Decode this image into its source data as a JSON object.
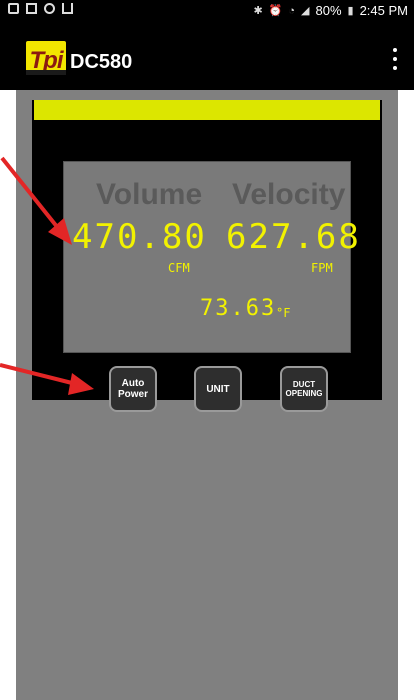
{
  "status_bar": {
    "battery": "80%",
    "time": "2:45 PM"
  },
  "app_bar": {
    "logo_text": "Tpi",
    "title": "DC580"
  },
  "display": {
    "volume_label": "Volume",
    "velocity_label": "Velocity",
    "volume_value": "470.80",
    "velocity_value": "627.68",
    "volume_unit": "CFM",
    "velocity_unit": "FPM",
    "temperature_value": "73.63",
    "temperature_unit": "°F"
  },
  "buttons": {
    "auto_power": "Auto Power",
    "unit": "UNIT",
    "duct_opening": "DUCT OPENING"
  },
  "colors": {
    "accent_yellow": "#dce600",
    "lcd_text": "#f2f200",
    "arrow_red": "#e32626"
  }
}
